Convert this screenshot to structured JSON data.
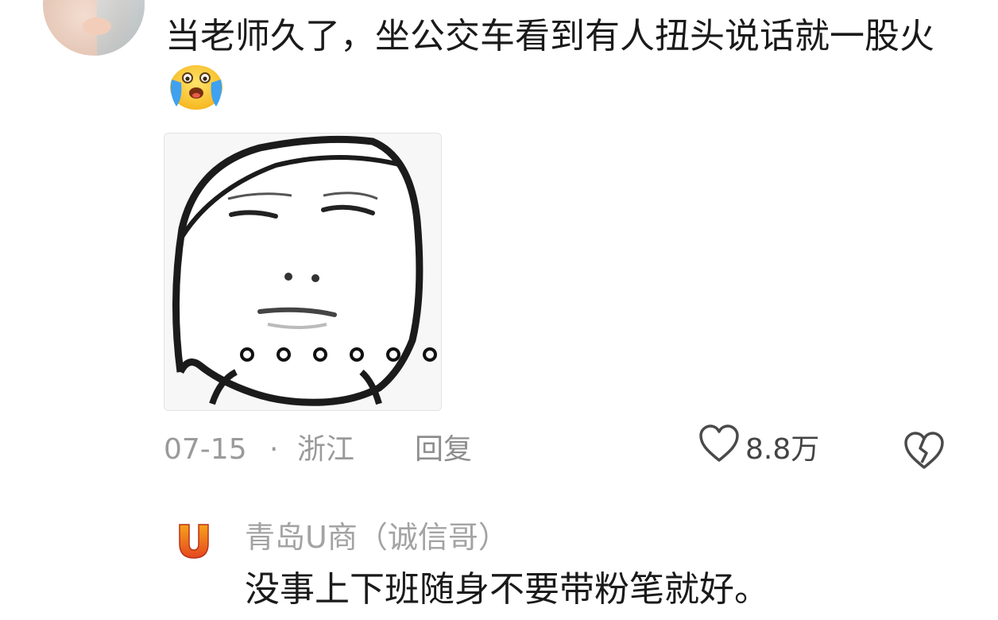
{
  "comment": {
    "text": "当老师久了，坐公交车看到有人扭头说话就一股火",
    "emoji": "crying-laughing-emoji",
    "image": "meme-face-sticker",
    "meme_caption": "。。。。。。",
    "date": "07-15",
    "separator": "·",
    "location": "浙江",
    "reply_label": "回复",
    "like_count": "8.8万"
  },
  "reply": {
    "author": "青岛U商（诚信哥）",
    "text": "没事上下班随身不要带粉笔就好。"
  },
  "colors": {
    "text": "#1a1a1a",
    "meta": "#9a9a9a",
    "avatar_u_gradient_top": "#f7a21b",
    "avatar_u_gradient_bottom": "#e4471f"
  }
}
